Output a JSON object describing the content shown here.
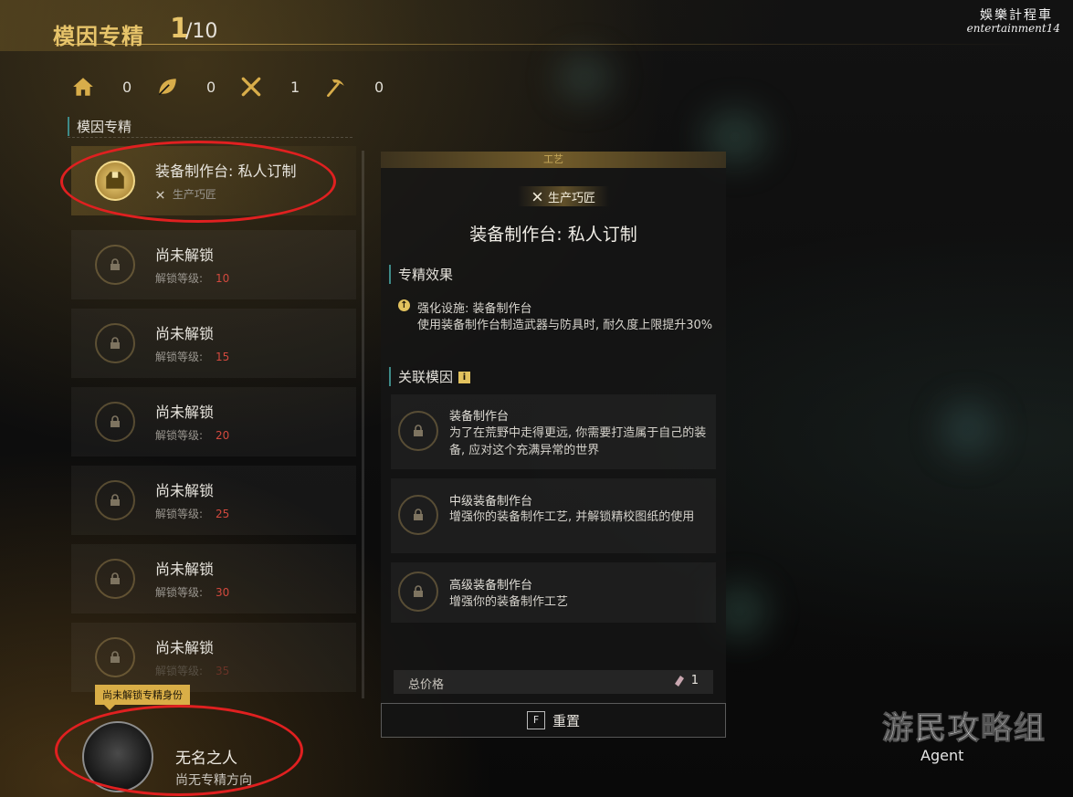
{
  "header": {
    "title": "模因专精",
    "count": "1",
    "total": "/10"
  },
  "watermark": {
    "line1": "娛樂計程車",
    "line2": "entertainment14"
  },
  "stats": [
    {
      "icon": "house-icon",
      "value": "0"
    },
    {
      "icon": "leaf-icon",
      "value": "0"
    },
    {
      "icon": "crossed-tools-icon",
      "value": "1"
    },
    {
      "icon": "pickaxe-icon",
      "value": "0"
    }
  ],
  "left": {
    "section_title": "模因专精",
    "slots": [
      {
        "title": "装备制作台: 私人订制",
        "sub_label": "生产巧匠",
        "active": true
      },
      {
        "title": "尚未解锁",
        "sub_label": "解锁等级:",
        "level": "10"
      },
      {
        "title": "尚未解锁",
        "sub_label": "解锁等级:",
        "level": "15"
      },
      {
        "title": "尚未解锁",
        "sub_label": "解锁等级:",
        "level": "20"
      },
      {
        "title": "尚未解锁",
        "sub_label": "解锁等级:",
        "level": "25"
      },
      {
        "title": "尚未解锁",
        "sub_label": "解锁等级:",
        "level": "30"
      },
      {
        "title": "尚未解锁",
        "sub_label": "解锁等级:",
        "level": "35"
      }
    ]
  },
  "player": {
    "badge": "尚未解锁专精身份",
    "name": "无名之人",
    "subtitle": "尚无专精方向"
  },
  "detail": {
    "header": "工艺",
    "category": "生产巧匠",
    "title": "装备制作台: 私人订制",
    "effect_title": "专精效果",
    "effect_name": "强化设施: 装备制作台",
    "effect_desc": "使用装备制作台制造武器与防具时, 耐久度上限提升30%",
    "related_title": "关联模因",
    "related": [
      {
        "title": "装备制作台",
        "desc": "为了在荒野中走得更远, 你需要打造属于自己的装备, 应对这个充满异常的世界"
      },
      {
        "title": "中级装备制作台",
        "desc": "增强你的装备制作工艺, 并解锁精校图纸的使用"
      },
      {
        "title": "高级装备制作台",
        "desc": "增强你的装备制作工艺"
      }
    ],
    "total_label": "总价格",
    "total_value": "1",
    "reset_key": "F",
    "reset_label": "重置"
  },
  "branding": {
    "name": "游民攻略组",
    "sub": "Agent"
  },
  "colors": {
    "gold": "#e7c46a",
    "accent_teal": "#3e8a88",
    "locked_level_red": "#d2493e",
    "annotation_red": "#e02020"
  }
}
